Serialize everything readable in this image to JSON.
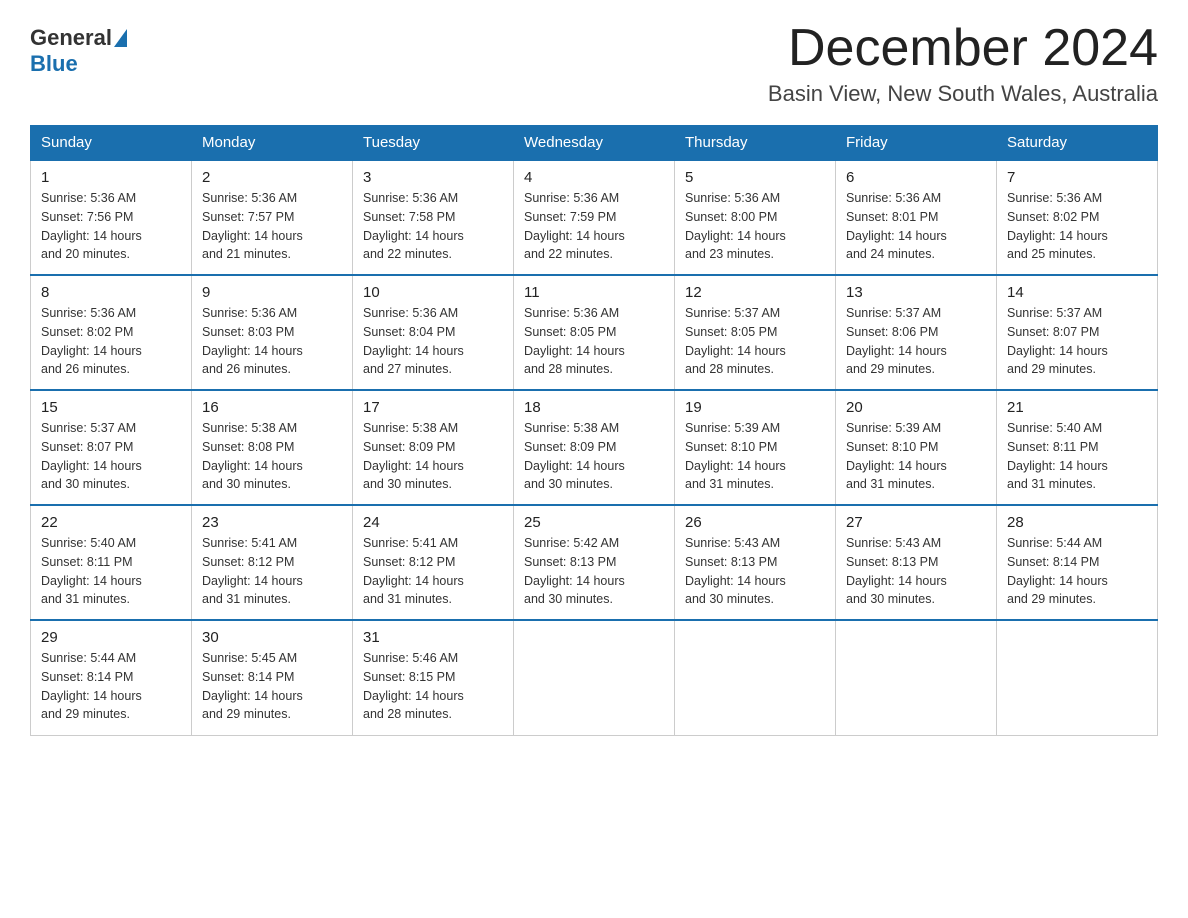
{
  "header": {
    "logo_general": "General",
    "logo_blue": "Blue",
    "month_title": "December 2024",
    "location": "Basin View, New South Wales, Australia"
  },
  "days_of_week": [
    "Sunday",
    "Monday",
    "Tuesday",
    "Wednesday",
    "Thursday",
    "Friday",
    "Saturday"
  ],
  "weeks": [
    [
      {
        "day": "1",
        "sunrise": "5:36 AM",
        "sunset": "7:56 PM",
        "daylight": "14 hours and 20 minutes."
      },
      {
        "day": "2",
        "sunrise": "5:36 AM",
        "sunset": "7:57 PM",
        "daylight": "14 hours and 21 minutes."
      },
      {
        "day": "3",
        "sunrise": "5:36 AM",
        "sunset": "7:58 PM",
        "daylight": "14 hours and 22 minutes."
      },
      {
        "day": "4",
        "sunrise": "5:36 AM",
        "sunset": "7:59 PM",
        "daylight": "14 hours and 22 minutes."
      },
      {
        "day": "5",
        "sunrise": "5:36 AM",
        "sunset": "8:00 PM",
        "daylight": "14 hours and 23 minutes."
      },
      {
        "day": "6",
        "sunrise": "5:36 AM",
        "sunset": "8:01 PM",
        "daylight": "14 hours and 24 minutes."
      },
      {
        "day": "7",
        "sunrise": "5:36 AM",
        "sunset": "8:02 PM",
        "daylight": "14 hours and 25 minutes."
      }
    ],
    [
      {
        "day": "8",
        "sunrise": "5:36 AM",
        "sunset": "8:02 PM",
        "daylight": "14 hours and 26 minutes."
      },
      {
        "day": "9",
        "sunrise": "5:36 AM",
        "sunset": "8:03 PM",
        "daylight": "14 hours and 26 minutes."
      },
      {
        "day": "10",
        "sunrise": "5:36 AM",
        "sunset": "8:04 PM",
        "daylight": "14 hours and 27 minutes."
      },
      {
        "day": "11",
        "sunrise": "5:36 AM",
        "sunset": "8:05 PM",
        "daylight": "14 hours and 28 minutes."
      },
      {
        "day": "12",
        "sunrise": "5:37 AM",
        "sunset": "8:05 PM",
        "daylight": "14 hours and 28 minutes."
      },
      {
        "day": "13",
        "sunrise": "5:37 AM",
        "sunset": "8:06 PM",
        "daylight": "14 hours and 29 minutes."
      },
      {
        "day": "14",
        "sunrise": "5:37 AM",
        "sunset": "8:07 PM",
        "daylight": "14 hours and 29 minutes."
      }
    ],
    [
      {
        "day": "15",
        "sunrise": "5:37 AM",
        "sunset": "8:07 PM",
        "daylight": "14 hours and 30 minutes."
      },
      {
        "day": "16",
        "sunrise": "5:38 AM",
        "sunset": "8:08 PM",
        "daylight": "14 hours and 30 minutes."
      },
      {
        "day": "17",
        "sunrise": "5:38 AM",
        "sunset": "8:09 PM",
        "daylight": "14 hours and 30 minutes."
      },
      {
        "day": "18",
        "sunrise": "5:38 AM",
        "sunset": "8:09 PM",
        "daylight": "14 hours and 30 minutes."
      },
      {
        "day": "19",
        "sunrise": "5:39 AM",
        "sunset": "8:10 PM",
        "daylight": "14 hours and 31 minutes."
      },
      {
        "day": "20",
        "sunrise": "5:39 AM",
        "sunset": "8:10 PM",
        "daylight": "14 hours and 31 minutes."
      },
      {
        "day": "21",
        "sunrise": "5:40 AM",
        "sunset": "8:11 PM",
        "daylight": "14 hours and 31 minutes."
      }
    ],
    [
      {
        "day": "22",
        "sunrise": "5:40 AM",
        "sunset": "8:11 PM",
        "daylight": "14 hours and 31 minutes."
      },
      {
        "day": "23",
        "sunrise": "5:41 AM",
        "sunset": "8:12 PM",
        "daylight": "14 hours and 31 minutes."
      },
      {
        "day": "24",
        "sunrise": "5:41 AM",
        "sunset": "8:12 PM",
        "daylight": "14 hours and 31 minutes."
      },
      {
        "day": "25",
        "sunrise": "5:42 AM",
        "sunset": "8:13 PM",
        "daylight": "14 hours and 30 minutes."
      },
      {
        "day": "26",
        "sunrise": "5:43 AM",
        "sunset": "8:13 PM",
        "daylight": "14 hours and 30 minutes."
      },
      {
        "day": "27",
        "sunrise": "5:43 AM",
        "sunset": "8:13 PM",
        "daylight": "14 hours and 30 minutes."
      },
      {
        "day": "28",
        "sunrise": "5:44 AM",
        "sunset": "8:14 PM",
        "daylight": "14 hours and 29 minutes."
      }
    ],
    [
      {
        "day": "29",
        "sunrise": "5:44 AM",
        "sunset": "8:14 PM",
        "daylight": "14 hours and 29 minutes."
      },
      {
        "day": "30",
        "sunrise": "5:45 AM",
        "sunset": "8:14 PM",
        "daylight": "14 hours and 29 minutes."
      },
      {
        "day": "31",
        "sunrise": "5:46 AM",
        "sunset": "8:15 PM",
        "daylight": "14 hours and 28 minutes."
      },
      null,
      null,
      null,
      null
    ]
  ],
  "labels": {
    "sunrise": "Sunrise:",
    "sunset": "Sunset:",
    "daylight": "Daylight:"
  }
}
